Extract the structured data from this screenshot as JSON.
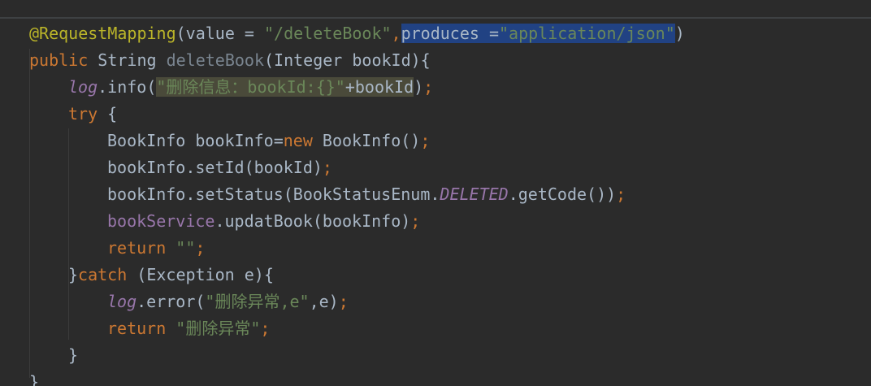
{
  "editor": {
    "language": "java",
    "colors": {
      "background": "#2b2b2b",
      "annotation": "#bbb529",
      "keyword": "#cc7832",
      "string": "#6a8759",
      "identifier": "#a9b7c6",
      "field": "#9876aa",
      "selection": "#214283"
    },
    "lines": [
      {
        "tokens": [
          {
            "text": "@RequestMapping",
            "type": "ann"
          },
          {
            "text": "(value = ",
            "type": "plain"
          },
          {
            "text": "\"/deleteBook\"",
            "type": "str"
          },
          {
            "text": ",",
            "type": "kw"
          },
          {
            "text": "produces =",
            "type": "plain sel"
          },
          {
            "text": "\"application/json\"",
            "type": "str sel"
          },
          {
            "text": ")",
            "type": "plain"
          }
        ]
      },
      {
        "tokens": [
          {
            "text": "public ",
            "type": "kw"
          },
          {
            "text": "String ",
            "type": "plain"
          },
          {
            "text": "deleteBook",
            "type": "dim"
          },
          {
            "text": "(Integer bookId){",
            "type": "plain"
          }
        ]
      },
      {
        "tokens": [
          {
            "text": "log",
            "type": "static-field"
          },
          {
            "text": ".info(",
            "type": "plain"
          },
          {
            "text": "\"删除信息：bookId:{}\"",
            "type": "str hl"
          },
          {
            "text": "+bookId",
            "type": "plain hl"
          },
          {
            "text": ")",
            "type": "plain"
          },
          {
            "text": ";",
            "type": "semi"
          }
        ]
      },
      {
        "tokens": [
          {
            "text": "try ",
            "type": "kw"
          },
          {
            "text": "{",
            "type": "plain"
          }
        ]
      },
      {
        "tokens": [
          {
            "text": "BookInfo bookInfo=",
            "type": "plain"
          },
          {
            "text": "new ",
            "type": "kw"
          },
          {
            "text": "BookInfo()",
            "type": "plain"
          },
          {
            "text": ";",
            "type": "semi"
          }
        ]
      },
      {
        "tokens": [
          {
            "text": "bookInfo.setId(bookId)",
            "type": "plain"
          },
          {
            "text": ";",
            "type": "semi"
          }
        ]
      },
      {
        "tokens": [
          {
            "text": "bookInfo.setStatus(BookStatusEnum.",
            "type": "plain"
          },
          {
            "text": "DELETED",
            "type": "static-field"
          },
          {
            "text": ".getCode())",
            "type": "plain"
          },
          {
            "text": ";",
            "type": "semi"
          }
        ]
      },
      {
        "tokens": [
          {
            "text": "bookService",
            "type": "field"
          },
          {
            "text": ".updatBook(bookInfo)",
            "type": "plain"
          },
          {
            "text": ";",
            "type": "semi"
          }
        ]
      },
      {
        "tokens": [
          {
            "text": "return ",
            "type": "kw"
          },
          {
            "text": "\"\"",
            "type": "str"
          },
          {
            "text": ";",
            "type": "semi"
          }
        ]
      },
      {
        "tokens": [
          {
            "text": "}",
            "type": "plain"
          },
          {
            "text": "catch ",
            "type": "kw"
          },
          {
            "text": "(Exception e){",
            "type": "plain"
          }
        ]
      },
      {
        "tokens": [
          {
            "text": "log",
            "type": "static-field"
          },
          {
            "text": ".error(",
            "type": "plain"
          },
          {
            "text": "\"删除异常,e\"",
            "type": "str"
          },
          {
            "text": ",e)",
            "type": "plain"
          },
          {
            "text": ";",
            "type": "semi"
          }
        ]
      },
      {
        "tokens": [
          {
            "text": "return ",
            "type": "kw"
          },
          {
            "text": "\"删除异常\"",
            "type": "str"
          },
          {
            "text": ";",
            "type": "semi"
          }
        ]
      },
      {
        "tokens": [
          {
            "text": "}",
            "type": "plain"
          }
        ]
      },
      {
        "tokens": [
          {
            "text": "}",
            "type": "plain"
          }
        ]
      }
    ]
  }
}
